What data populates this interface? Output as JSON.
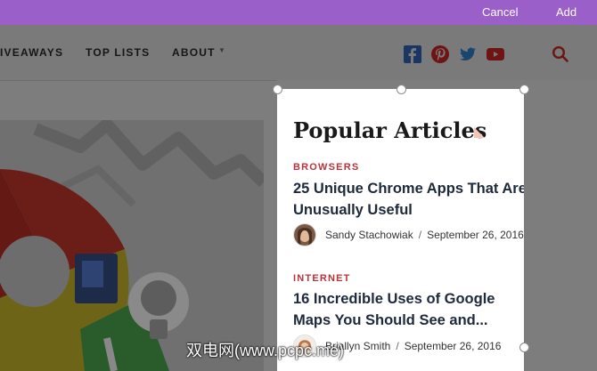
{
  "capture_bar": {
    "cancel_label": "Cancel",
    "add_label": "Add",
    "color": "#9a5fc9"
  },
  "nav": {
    "items": [
      "IVEAWAYS",
      "TOP LISTS",
      "ABOUT"
    ],
    "social_icons": [
      "facebook-icon",
      "pinterest-icon",
      "twitter-icon",
      "youtube-icon"
    ],
    "search_icon": "search-icon"
  },
  "widget": {
    "title": "Popular Articles",
    "articles": [
      {
        "category": "BROWSERS",
        "title": "25 Unique Chrome Apps That Are Unusually Useful",
        "author": "Sandy Stachowiak",
        "separator": "/",
        "date": "September 26, 2016"
      },
      {
        "category": "INTERNET",
        "title": "16 Incredible Uses of Google Maps You Should See and...",
        "author": "Briallyn Smith",
        "separator": "/",
        "date": "September 26, 2016"
      }
    ],
    "category_color": "#b8343b"
  },
  "watermark": "双电网(www.pcpc.me)"
}
